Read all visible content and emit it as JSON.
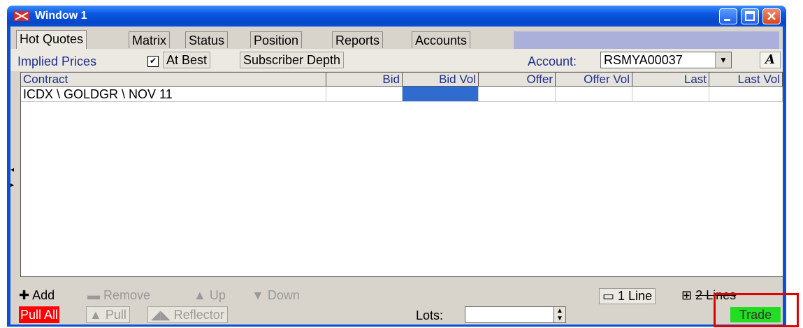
{
  "window": {
    "title": "Window 1"
  },
  "tabs": [
    {
      "label": "Hot Quotes",
      "active": true
    },
    {
      "label": "Matrix",
      "active": false
    },
    {
      "label": "Status",
      "active": false
    },
    {
      "label": "Position",
      "active": false
    },
    {
      "label": "Reports",
      "active": false
    },
    {
      "label": "Accounts",
      "active": false
    }
  ],
  "toolbar": {
    "implied_prices_label": "Implied Prices",
    "implied_prices_checked": true,
    "at_best_label": "At Best",
    "subscriber_depth_label": "Subscriber Depth",
    "account_label": "Account:",
    "account_value": "RSMYA00037",
    "font_button": "A"
  },
  "grid": {
    "columns": [
      "Contract",
      "Bid",
      "Bid Vol",
      "Offer",
      "Offer Vol",
      "Last",
      "Last Vol"
    ],
    "rows": [
      {
        "contract": "ICDX \\ GOLDGR \\ NOV 11",
        "bid": "",
        "bid_vol": "",
        "offer": "",
        "offer_vol": "",
        "last": "",
        "last_vol": ""
      }
    ]
  },
  "row_actions": {
    "add": "Add",
    "remove": "Remove",
    "up": "Up",
    "down": "Down",
    "one_line": "1 Line",
    "two_lines": "2 Lines"
  },
  "bottom_bar": {
    "pull_all": "Pull All",
    "pull": "Pull",
    "reflector": "Reflector",
    "lots_label": "Lots:",
    "lots_value": "",
    "trade": "Trade"
  },
  "colors": {
    "pull_all_bg": "#ff0000",
    "trade_bg": "#22dd22",
    "selected_cell": "#2f6cd0",
    "highlight": "#e00000"
  }
}
